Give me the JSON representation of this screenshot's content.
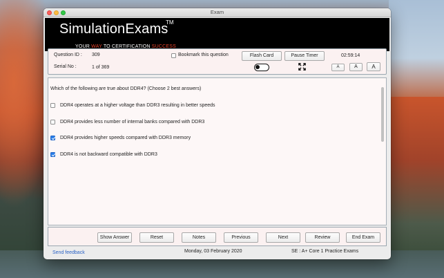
{
  "window": {
    "title": "Exam"
  },
  "banner": {
    "brand": "SimulationExams",
    "trademark": "TM",
    "tagline_parts": [
      "YOUR ",
      "WAY",
      " TO CERTIFICATION ",
      "SUCCESS"
    ]
  },
  "info": {
    "question_id_label": "Question ID :",
    "question_id": "309",
    "serial_label": "Serial No :",
    "serial": "1 of 369",
    "bookmark_label": "Bookmark this question",
    "bookmark_checked": false,
    "flash_card_label": "Flash Card",
    "pause_timer_label": "Pause Timer",
    "timer": "02:59:14",
    "font_buttons": [
      "A",
      "A",
      "A"
    ]
  },
  "question": {
    "text": "Which of the following are true about DDR4? (Choose 2 best answers)",
    "options": [
      {
        "text": "DDR4 operates at a higher voltage than DDR3 resulting in better speeds",
        "checked": false
      },
      {
        "text": "DDR4 provides less number of internal banks compared with DDR3",
        "checked": false
      },
      {
        "text": "DDR4 provides higher speeds compared with DDR3 memory",
        "checked": true
      },
      {
        "text": "DDR4 is not backward compatible with DDR3",
        "checked": true
      }
    ]
  },
  "actions": {
    "show_answer": "Show Answer",
    "reset": "Reset",
    "notes": "Notes",
    "previous": "Previous",
    "next": "Next",
    "review": "Review",
    "end_exam": "End Exam"
  },
  "footer": {
    "feedback": "Send feedback",
    "date": "Monday, 03 February 2020",
    "exam": "SE : A+ Core 1 Practice Exams"
  },
  "colors": {
    "accent_red": "#e8432b",
    "checkbox_blue": "#2a7ee8",
    "link_blue": "#2a62c5"
  }
}
